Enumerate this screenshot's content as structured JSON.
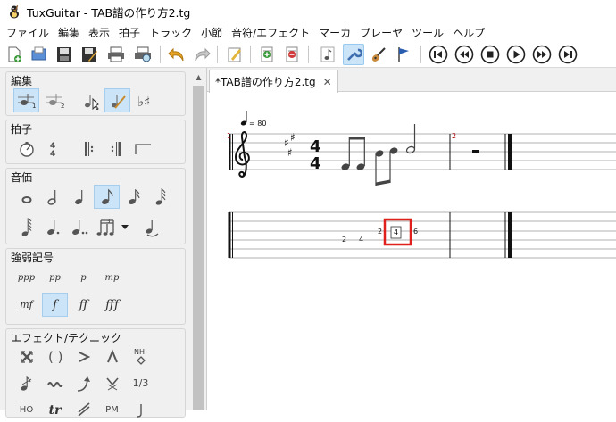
{
  "window": {
    "title": "TuxGuitar - TAB譜の作り方2.tg"
  },
  "menu": [
    "ファイル",
    "編集",
    "表示",
    "拍子",
    "トラック",
    "小節",
    "音符/エフェクト",
    "マーカ",
    "プレーヤ",
    "ツール",
    "ヘルプ"
  ],
  "toolbar": {
    "buttons": [
      "new-file",
      "open-file",
      "save",
      "save-as",
      "print",
      "print-preview",
      "undo",
      "redo",
      "edit-mode",
      "add-track",
      "remove-track",
      "fretboard",
      "tools",
      "guitar-settings",
      "marker",
      "first",
      "previous",
      "stop",
      "play",
      "next",
      "last"
    ]
  },
  "palette": {
    "edit": {
      "title": "編集"
    },
    "timesig": {
      "title": "拍子"
    },
    "duration": {
      "title": "音価"
    },
    "dynamics": {
      "title": "強弱記号",
      "labels": [
        "ppp",
        "pp",
        "p",
        "mp",
        "mf",
        "f",
        "ff",
        "fff"
      ]
    },
    "effects": {
      "title": "エフェクト/テクニック",
      "nh": "NH",
      "tuplet": "1/3",
      "ho": "HO",
      "tr": "tr",
      "pm": "PM"
    }
  },
  "document": {
    "tab_label": "*TAB譜の作り方2.tg",
    "tempo": "= 80",
    "measure1": "1",
    "measure2": "2",
    "time_signature": {
      "top": "4",
      "bottom": "4"
    },
    "tab_numbers": [
      "2",
      "4",
      "2",
      "4",
      "6"
    ]
  },
  "colors": {
    "selection_box": "#e0201b",
    "measure_number": "#aa0000",
    "toolbar_active": "#cce4f7"
  }
}
